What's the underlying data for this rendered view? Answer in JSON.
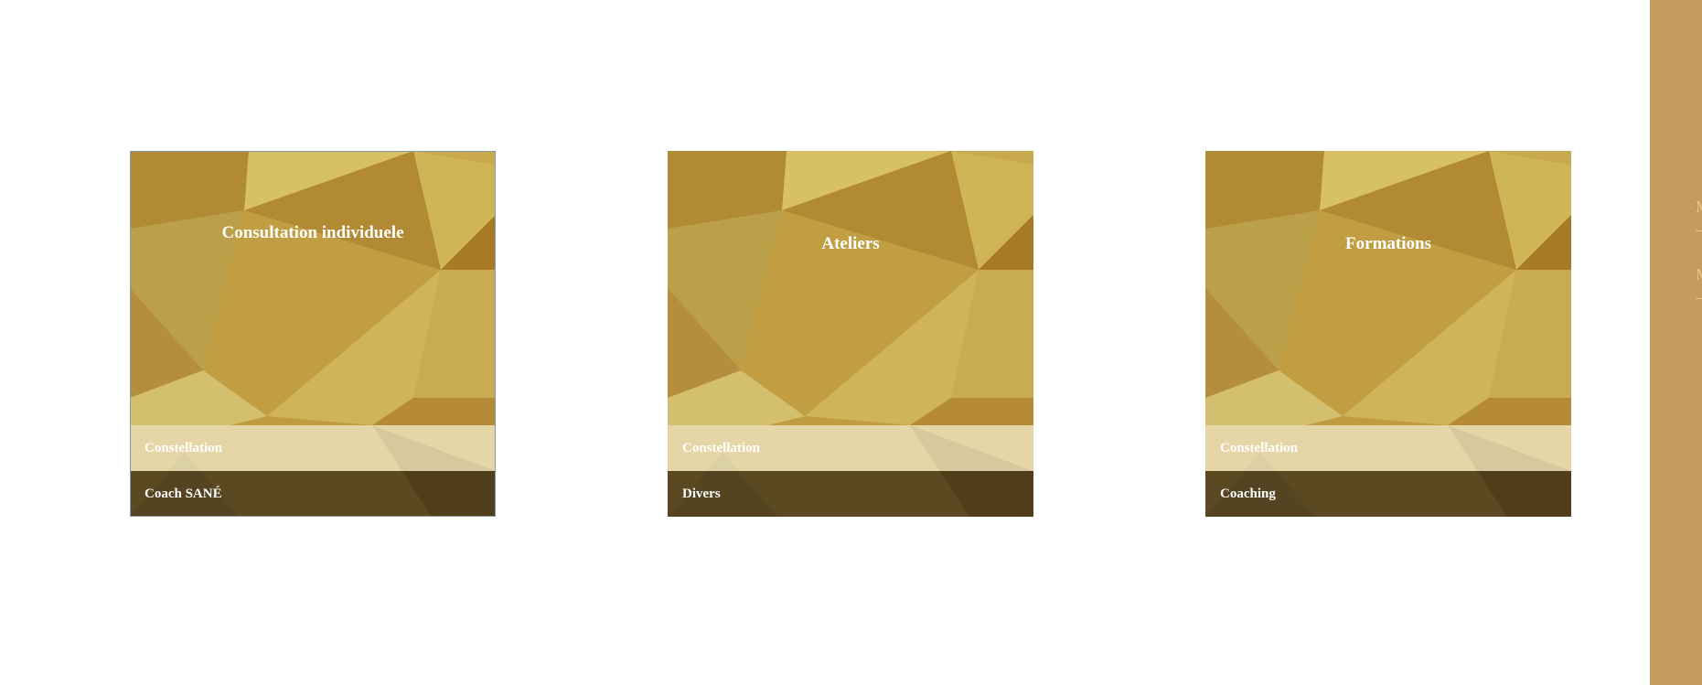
{
  "cards": [
    {
      "title": "Consultation individuele",
      "category": "Constellation",
      "tag": "Coach SANÉ"
    },
    {
      "title": "Ateliers",
      "category": "Constellation",
      "tag": "Divers"
    },
    {
      "title": "Formations",
      "category": "Constellation",
      "tag": "Coaching"
    }
  ],
  "sidebar": {
    "items": [
      "M",
      "M"
    ]
  },
  "colors": {
    "sidebar": "#c59c5e",
    "gold_light": "#d8c066",
    "gold_dark": "#a97f2a"
  }
}
